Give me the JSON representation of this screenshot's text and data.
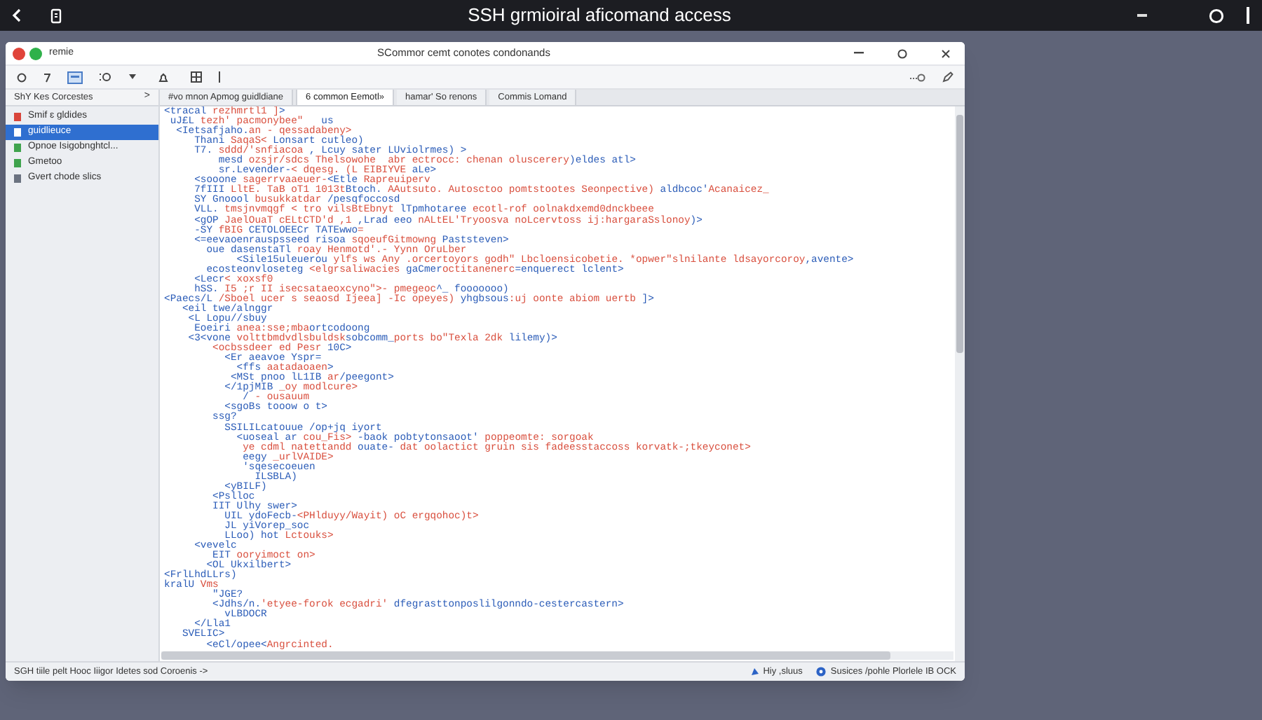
{
  "app_bar": {
    "title": "SSH grmioiral aficomand access"
  },
  "window": {
    "name": "remie",
    "title": "SCommor cemt conotes condonands"
  },
  "sidebar": {
    "header": "ShY Kes Corcestes",
    "chevron": ">",
    "items": [
      {
        "label": "Smif ɛ gldides",
        "selected": false,
        "color": "#d9443a"
      },
      {
        "label": "guidlieuce",
        "selected": true,
        "color": "#ffffff"
      },
      {
        "label": "Opnoe Isigobnghtcl...",
        "selected": false,
        "color": "#3fa34d"
      },
      {
        "label": "Gmetoo",
        "selected": false,
        "color": "#3fa34d"
      },
      {
        "label": "Gvert chode slics",
        "selected": false,
        "color": "#6b7280"
      }
    ]
  },
  "tabs": [
    {
      "label": "#vo mnon Apmog guidldiane",
      "selected": false
    },
    {
      "label": "6 common Eemotl»",
      "selected": true
    },
    {
      "label": "hamar' So renons",
      "selected": false
    },
    {
      "label": "Commis Lomand",
      "selected": false
    }
  ],
  "code": {
    "lines": [
      [
        {
          "kind": "tag",
          "text": "<tracal "
        },
        {
          "kind": "str",
          "text": "rezhmrtl1 ]"
        },
        {
          "kind": "tag",
          "text": ">"
        }
      ],
      [
        {
          "kind": "tag",
          "text": " uJ£L "
        },
        {
          "kind": "str",
          "text": "tezh' pacmonybee\""
        },
        {
          "kind": "tag",
          "text": "   us"
        }
      ],
      [
        {
          "kind": "tag",
          "text": "  <Ietsafjaho."
        },
        {
          "kind": "str",
          "text": "an - qessadabeny>"
        }
      ],
      [
        {
          "kind": "tag",
          "text": "     Thani "
        },
        {
          "kind": "str",
          "text": "SaqaS< "
        },
        {
          "kind": "tag",
          "text": "Lonsart cutleo)"
        }
      ],
      [
        {
          "kind": "tag",
          "text": "     T7. "
        },
        {
          "kind": "str",
          "text": "sddd/'snfiacoa"
        },
        {
          "kind": "tag",
          "text": " , Lcuy sater LUviolrmes) >"
        }
      ],
      [
        {
          "kind": "tag",
          "text": "         mesd "
        },
        {
          "kind": "str",
          "text": "ozsjr/sdcs Thelsowohe  abr ectrocc: chenan oluscerery"
        },
        {
          "kind": "tag",
          "text": ")eldes atl>"
        }
      ],
      [
        {
          "kind": "tag",
          "text": "         sr.Levender-"
        },
        {
          "kind": "str",
          "text": "< dqesg. (L EIBIYVE"
        },
        {
          "kind": "tag",
          "text": " aLe>"
        }
      ],
      [
        {
          "kind": "tag",
          "text": "     <sooone "
        },
        {
          "kind": "str",
          "text": "sagerrvaaeuer-"
        },
        {
          "kind": "tag",
          "text": "<Etle "
        },
        {
          "kind": "str",
          "text": "Rapreuiperv"
        }
      ],
      [
        {
          "kind": "tag",
          "text": "     7fIII "
        },
        {
          "kind": "str",
          "text": "LltE. TaB oT1 1013t"
        },
        {
          "kind": "tag",
          "text": "Btoch."
        },
        {
          "kind": "str",
          "text": " AAutsuto. Autosctoo pomtstootes Seonpective)"
        },
        {
          "kind": "tag",
          "text": " aldbcoc'"
        },
        {
          "kind": "str",
          "text": "Acanaicez_"
        }
      ],
      [
        {
          "kind": "tag",
          "text": "     SY Gnoool "
        },
        {
          "kind": "str",
          "text": "busukkatdar "
        },
        {
          "kind": "tag",
          "text": "/pesqfoccosd"
        }
      ],
      [
        {
          "kind": "tag",
          "text": "     VLL. "
        },
        {
          "kind": "str",
          "text": "tmsjnvmqgf < tro vilsBtEbnyt"
        },
        {
          "kind": "tag",
          "text": " lTpmhotaree "
        },
        {
          "kind": "str",
          "text": "ecotl-rof oolnakdxemd0dnckbeee"
        }
      ],
      [
        {
          "kind": "tag",
          "text": "     <gOP "
        },
        {
          "kind": "str",
          "text": "JaelOuaT cELtCTD'd ,1"
        },
        {
          "kind": "tag",
          "text": " ,Lrad eeo "
        },
        {
          "kind": "str",
          "text": "nALtEL'Tryoosva noLcervtoss ij:hargaraSslonoy"
        },
        {
          "kind": "tag",
          "text": ")>"
        }
      ],
      [
        {
          "kind": "tag",
          "text": "     -SY "
        },
        {
          "kind": "str",
          "text": "fBIG "
        },
        {
          "kind": "tag",
          "text": "CETOLOEECr TATEwwo"
        },
        {
          "kind": "str",
          "text": "="
        }
      ],
      [
        {
          "kind": "tag",
          "text": "     <=eevaoenrauspsseed risoa "
        },
        {
          "kind": "str",
          "text": "sqoeufGitmowng"
        },
        {
          "kind": "tag",
          "text": " Paststeven>"
        }
      ],
      [
        {
          "kind": "tag",
          "text": "       oue dasenstaTl "
        },
        {
          "kind": "str",
          "text": "roay Henmotd'.- Yynn OruLber"
        }
      ],
      [
        {
          "kind": "tag",
          "text": "            <Sile15uleuerou "
        },
        {
          "kind": "str",
          "text": "ylfs ws Any .orcertoyors godh\" Lbcloensicobetie. *opwer\"slnilante ldsayorcoroy"
        },
        {
          "kind": "tag",
          "text": ",avente>"
        }
      ],
      [
        {
          "kind": "tag",
          "text": "       ecosteonvloseteg "
        },
        {
          "kind": "str",
          "text": "<elgrsaliwacies"
        },
        {
          "kind": "tag",
          "text": " gaCmer"
        },
        {
          "kind": "str",
          "text": "octitanenerc"
        },
        {
          "kind": "tag",
          "text": "=enquerect lclent>"
        }
      ],
      [
        {
          "kind": "tag",
          "text": "     <Lecr"
        },
        {
          "kind": "str",
          "text": "< xoxsf0"
        }
      ],
      [
        {
          "kind": "tag",
          "text": "     hSS. "
        },
        {
          "kind": "str",
          "text": "I5 ;r II isecsataeoxcyno\">- pmegeoc"
        },
        {
          "kind": "tag",
          "text": "^_ fooooooo)"
        }
      ],
      [
        {
          "kind": "tag",
          "text": "<Paecs/L "
        },
        {
          "kind": "str",
          "text": "/Sboel ucer s seaosd Ijeea] -Ic opeyes)"
        },
        {
          "kind": "tag",
          "text": " yhgbsous"
        },
        {
          "kind": "str",
          "text": ":uj oonte abiom uertb"
        },
        {
          "kind": "tag",
          "text": " ]>"
        }
      ],
      [
        {
          "kind": "tag",
          "text": "   <eil twe/alnggr"
        }
      ],
      [
        {
          "kind": "tag",
          "text": "    <L Lopu//sbuy"
        }
      ],
      [
        {
          "kind": "tag",
          "text": "     Eoeiri "
        },
        {
          "kind": "str",
          "text": "anea:sse;mba"
        },
        {
          "kind": "tag",
          "text": "ortcodoong"
        }
      ],
      [
        {
          "kind": "tag",
          "text": "    <3<vone "
        },
        {
          "kind": "str",
          "text": "volttbmdvdlsbuldsk"
        },
        {
          "kind": "tag",
          "text": "sobcomm_"
        },
        {
          "kind": "str",
          "text": "ports bo\"Texla 2dk "
        },
        {
          "kind": "tag",
          "text": "lilemy)>"
        }
      ],
      [
        {
          "kind": "str",
          "text": "        <ocbssdeer ed Pesr"
        },
        {
          "kind": "tag",
          "text": " 10C>"
        }
      ],
      [
        {
          "kind": "tag",
          "text": "          <Er aeavoe Yspr="
        }
      ],
      [
        {
          "kind": "tag",
          "text": "            <ffs "
        },
        {
          "kind": "str",
          "text": "aatadaoaen"
        },
        {
          "kind": "tag",
          "text": ">"
        }
      ],
      [
        {
          "kind": "tag",
          "text": "           <MSt pnoo lL1IB "
        },
        {
          "kind": "str",
          "text": "ar"
        },
        {
          "kind": "tag",
          "text": "/peegont>"
        }
      ],
      [
        {
          "kind": "tag",
          "text": "          </1pjMIB "
        },
        {
          "kind": "str",
          "text": "_oy modlcure>"
        }
      ],
      [
        {
          "kind": "tag",
          "text": "             / "
        },
        {
          "kind": "str",
          "text": "- ousauum"
        }
      ],
      [
        {
          "kind": "tag",
          "text": "          <sgoBs tooow o t>"
        }
      ],
      [
        {
          "kind": "tag",
          "text": "        ssg?"
        }
      ],
      [
        {
          "kind": "tag",
          "text": "          SSILILcatouue /op+jq iyort"
        }
      ],
      [
        {
          "kind": "tag",
          "text": "            <uoseal ar "
        },
        {
          "kind": "str",
          "text": "cou_Fis> "
        },
        {
          "kind": "tag",
          "text": "-baok pobtytonsaoot' "
        },
        {
          "kind": "str",
          "text": "poppeomte: sorgoak"
        }
      ],
      [
        {
          "kind": "str",
          "text": "             ye cdml natettandd "
        },
        {
          "kind": "tag",
          "text": "ouate- "
        },
        {
          "kind": "str",
          "text": "dat oolactict gruin sis fadeesstaccoss korvatk-;tkeyconet>"
        }
      ],
      [
        {
          "kind": "tag",
          "text": "             eegy "
        },
        {
          "kind": "str",
          "text": "_urlVAIDE>"
        }
      ],
      [
        {
          "kind": "tag",
          "text": "             'sqesecoeuen"
        }
      ],
      [
        {
          "kind": "tag",
          "text": "               ILSBLA)"
        }
      ],
      [
        {
          "kind": "tag",
          "text": "          <yBILF)"
        }
      ],
      [
        {
          "kind": "tag",
          "text": "        <Pslloc"
        }
      ],
      [
        {
          "kind": "tag",
          "text": "        IIT Ulhy swer>"
        }
      ],
      [
        {
          "kind": "tag",
          "text": "          UIL ydoFecb-"
        },
        {
          "kind": "str",
          "text": "<PHlduyy/Wayit) oC ergqohoc)t>"
        }
      ],
      [
        {
          "kind": "tag",
          "text": "          JL yiVorep_soc"
        }
      ],
      [
        {
          "kind": "tag",
          "text": "          LLoo) hot "
        },
        {
          "kind": "str",
          "text": "Lctouks>"
        }
      ],
      [
        {
          "kind": "tag",
          "text": "     <vevelc"
        }
      ],
      [
        {
          "kind": "tag",
          "text": "        EIT "
        },
        {
          "kind": "str",
          "text": "ooryimoct on>"
        }
      ],
      [
        {
          "kind": "tag",
          "text": "       <OL Ukxilbert>"
        }
      ],
      [
        {
          "kind": "tag",
          "text": "<FrlLhdLLrs)"
        }
      ],
      [
        {
          "kind": "tag",
          "text": "kralU "
        },
        {
          "kind": "str",
          "text": "Vms"
        }
      ],
      [
        {
          "kind": "tag",
          "text": "        \"JGE?"
        }
      ],
      [
        {
          "kind": "tag",
          "text": "        <Jdhs/n."
        },
        {
          "kind": "str",
          "text": "'etyee-forok ecgadri' "
        },
        {
          "kind": "tag",
          "text": "dfegrasttonposlilgonndo-cestercastern>"
        }
      ],
      [
        {
          "kind": "tag",
          "text": "          vLBDOCR"
        }
      ],
      [
        {
          "kind": "tag",
          "text": "     </Lla1"
        }
      ],
      [
        {
          "kind": "tag",
          "text": "   SVELIC>"
        }
      ],
      [
        {
          "kind": "tag",
          "text": "       <eCl/opee<"
        },
        {
          "kind": "str",
          "text": "Angrcinted."
        }
      ]
    ]
  },
  "status_bar": {
    "left": "SGH tiile pelt Hooc Iiigor Idetes sod Coroenis ->",
    "right": [
      "Hiy ,sluus",
      "Susices /pohle Plorlele IB OCK"
    ]
  }
}
